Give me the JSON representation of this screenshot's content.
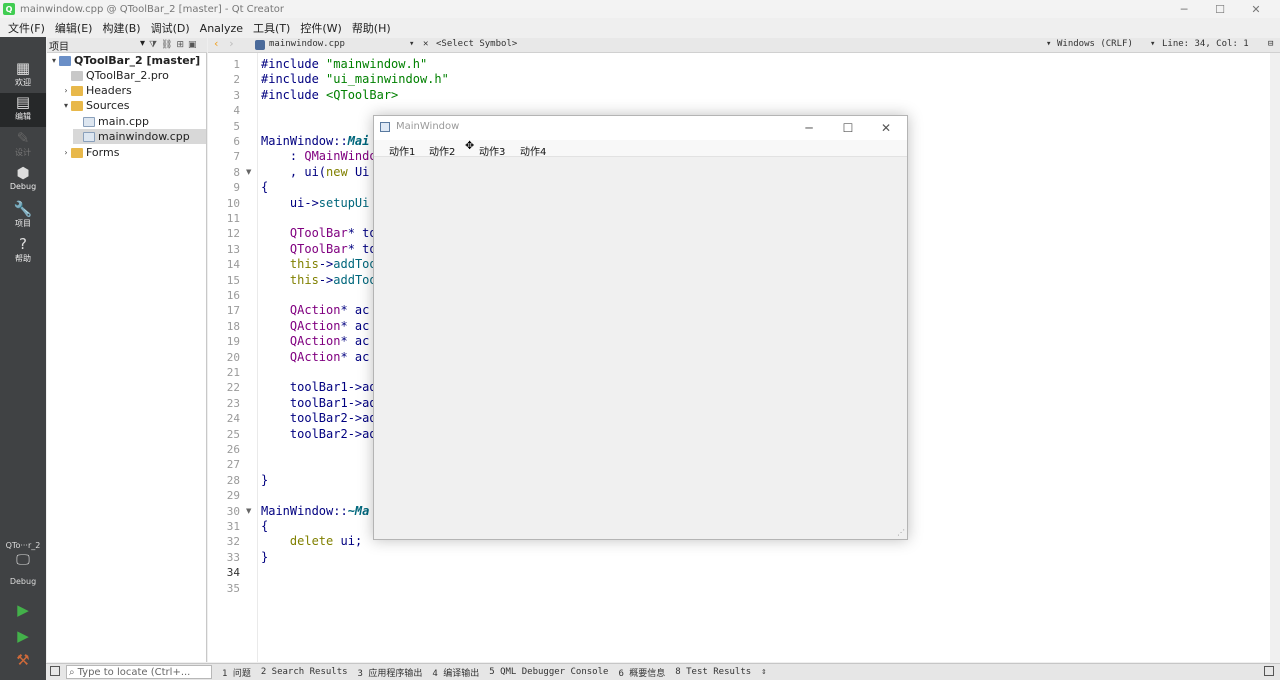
{
  "window": {
    "title": "mainwindow.cpp @ QToolBar_2 [master] - Qt Creator",
    "controls": {
      "minimize": "─",
      "maximize": "☐",
      "close": "✕"
    }
  },
  "menubar": {
    "items": [
      "文件(F)",
      "编辑(E)",
      "构建(B)",
      "调试(D)",
      "Analyze",
      "工具(T)",
      "控件(W)",
      "帮助(H)"
    ]
  },
  "modes": [
    {
      "label": "欢迎",
      "icon": "grid-icon",
      "glyph": "▦"
    },
    {
      "label": "编辑",
      "icon": "edit-icon",
      "glyph": "▤"
    },
    {
      "label": "设计",
      "icon": "design-icon",
      "glyph": "✎"
    },
    {
      "label": "Debug",
      "icon": "bug-icon",
      "glyph": "⬢"
    },
    {
      "label": "项目",
      "icon": "wrench-icon",
      "glyph": "🔧"
    },
    {
      "label": "帮助",
      "icon": "help-icon",
      "glyph": "?"
    }
  ],
  "kit": {
    "name": "QTo···r_2",
    "config": "Debug"
  },
  "project_pane": {
    "header": "项目",
    "tree": [
      {
        "label": "QToolBar_2 [master]",
        "level": 0,
        "arrow": "▾",
        "bold": true,
        "icon_color": "#6a8fc7"
      },
      {
        "label": "QToolBar_2.pro",
        "level": 1,
        "arrow": "",
        "icon_color": "#c8c8c8"
      },
      {
        "label": "Headers",
        "level": 1,
        "arrow": "›",
        "icon_color": "#e8b84a"
      },
      {
        "label": "Sources",
        "level": 1,
        "arrow": "▾",
        "icon_color": "#e8b84a"
      },
      {
        "label": "main.cpp",
        "level": 2,
        "arrow": "",
        "icon_color": "#dde6f0"
      },
      {
        "label": "mainwindow.cpp",
        "level": 2,
        "arrow": "",
        "icon_color": "#dde6f0",
        "selected": true
      },
      {
        "label": "Forms",
        "level": 1,
        "arrow": "›",
        "icon_color": "#e8b84a"
      }
    ]
  },
  "editor_toolbar": {
    "file": "mainwindow.cpp",
    "symbol": "<Select Symbol>",
    "line_ending": "Windows (CRLF)",
    "position": "Line: 34, Col: 1"
  },
  "code": {
    "current_line": 34,
    "fold_lines": [
      8,
      30
    ],
    "lines": [
      "#include \"mainwindow.h\"",
      "#include \"ui_mainwindow.h\"",
      "#include <QToolBar>",
      "",
      "",
      "MainWindow::Mai",
      "    : QMainWindo",
      "    , ui(new Ui",
      "{",
      "    ui->setupUi",
      "",
      "    QToolBar* to",
      "    QToolBar* to",
      "    this->addToo",
      "    this->addToo",
      "",
      "    QAction* ac",
      "    QAction* ac",
      "    QAction* ac",
      "    QAction* ac",
      "",
      "    toolBar1->ad",
      "    toolBar1->ad",
      "    toolBar2->ad",
      "    toolBar2->ad",
      "",
      "",
      "}",
      "",
      "MainWindow::~Ma",
      "{",
      "    delete ui;",
      "}",
      "",
      ""
    ]
  },
  "colors": {
    "string": "#008000",
    "keyword": "#808000",
    "class": "#800080",
    "function": "#00677c",
    "default": "#000080"
  },
  "child_window": {
    "title": "MainWindow",
    "actions": [
      "动作1",
      "动作2",
      "动作3",
      "动作4"
    ]
  },
  "statusbar": {
    "locate_placeholder": "Type to locate (Ctrl+...",
    "panes": [
      "1 问题",
      "2 Search Results",
      "3 应用程序输出",
      "4 编译输出",
      "5 QML Debugger Console",
      "6 概要信息",
      "8 Test Results"
    ]
  }
}
